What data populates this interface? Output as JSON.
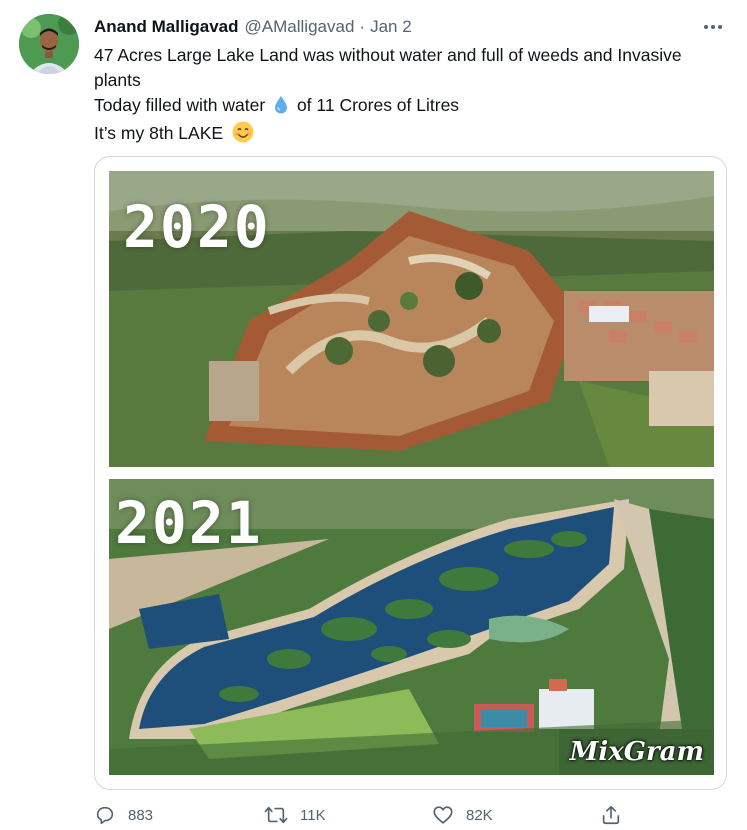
{
  "tweet": {
    "name": "Anand Malligavad",
    "handle": "@AMalligavad",
    "separator": "·",
    "date": "Jan 2",
    "lines": {
      "l1": "47 Acres Large Lake Land was without water and full of weeds and Invasive",
      "l2": "plants",
      "l3_a": "Today filled with water",
      "l3_b": "of 11 Crores of Litres",
      "l4": "It’s my 8th LAKE"
    },
    "emoji": {
      "drop": "droplet-icon",
      "smile": "smiling-face-icon"
    }
  },
  "media": {
    "photo_top_label": "2020",
    "photo_bottom_label": "2021",
    "watermark": "MixGram"
  },
  "actions": {
    "replies": "883",
    "retweets": "11K",
    "likes": "82K"
  },
  "icons": {
    "reply": "reply-icon",
    "retweet": "retweet-icon",
    "like": "heart-icon",
    "share": "share-icon",
    "more": "more-icon"
  },
  "colors": {
    "text": "#0f1419",
    "secondary": "#536471",
    "border": "#cfd9de",
    "water": "#1e4e7a",
    "soil": "#a0522d"
  }
}
